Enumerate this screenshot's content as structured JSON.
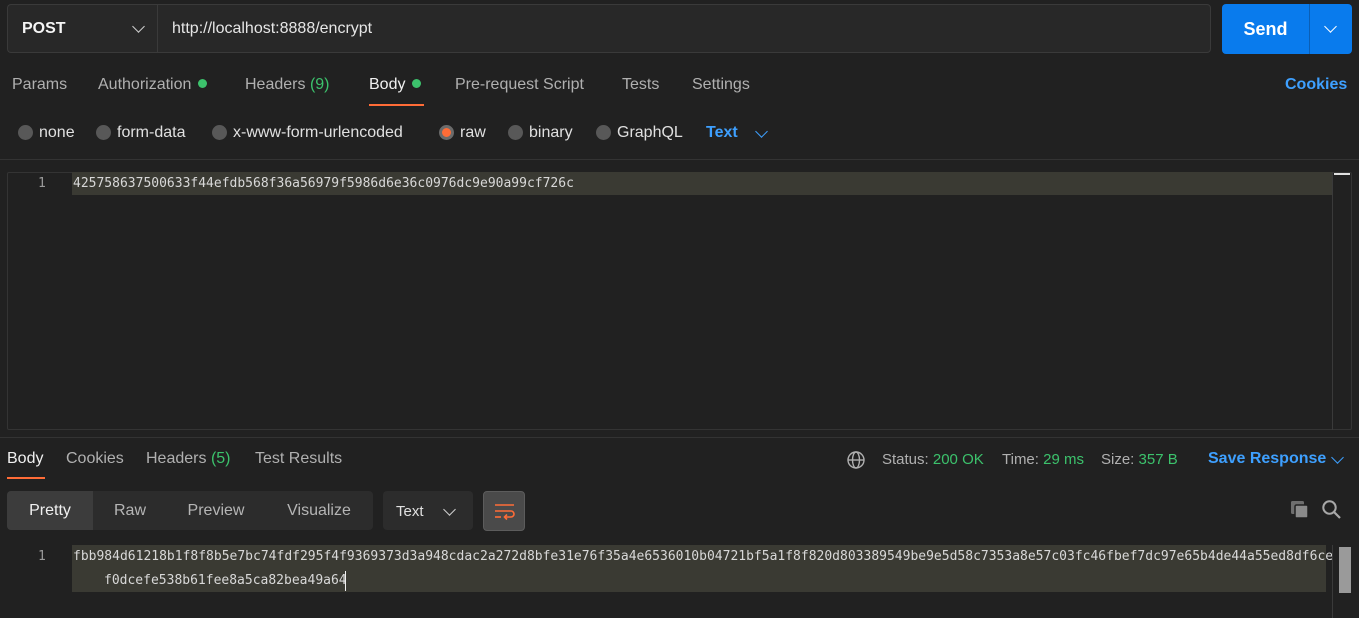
{
  "request": {
    "method": "POST",
    "url": "http://localhost:8888/encrypt",
    "send_label": "Send"
  },
  "request_tabs": {
    "params": "Params",
    "authorization": "Authorization",
    "headers": "Headers",
    "headers_count": "(9)",
    "body": "Body",
    "prerequest": "Pre-request Script",
    "tests": "Tests",
    "settings": "Settings",
    "cookies": "Cookies",
    "active": "Body"
  },
  "body_types": {
    "none": "none",
    "form_data": "form-data",
    "urlencoded": "x-www-form-urlencoded",
    "raw": "raw",
    "binary": "binary",
    "graphql": "GraphQL",
    "selected": "raw",
    "raw_format": "Text"
  },
  "request_body": {
    "line_number": "1",
    "content": "425758637500633f44efdb568f36a56979f5986d6e36c0976dc9e90a99cf726c"
  },
  "response_tabs": {
    "body": "Body",
    "cookies": "Cookies",
    "headers": "Headers",
    "headers_count": "(5)",
    "test_results": "Test Results",
    "active": "Body"
  },
  "response_meta": {
    "status_label": "Status:",
    "status_value": "200 OK",
    "time_label": "Time:",
    "time_value": "29 ms",
    "size_label": "Size:",
    "size_value": "357 B",
    "save_response": "Save Response"
  },
  "response_view": {
    "pretty": "Pretty",
    "raw": "Raw",
    "preview": "Preview",
    "visualize": "Visualize",
    "active": "Pretty",
    "format": "Text"
  },
  "response_body": {
    "line_number": "1",
    "line1": "fbb984d61218b1f8f8b5e7bc74fdf295f4f9369373d3a948cdac2a272d8bfe31e76f35a4e6536010b04721bf5a1f8f820d803389549be9e5d58c7353a8e57c03fc46fbef7dc97e65b4de44a55ed8df6ce",
    "line2": "f0dcefe538b61fee8a5ca82bea49a64"
  },
  "colors": {
    "accent": "#ff6c37",
    "link": "#3ea0ff",
    "success": "#3cc26c",
    "send": "#097bed"
  }
}
